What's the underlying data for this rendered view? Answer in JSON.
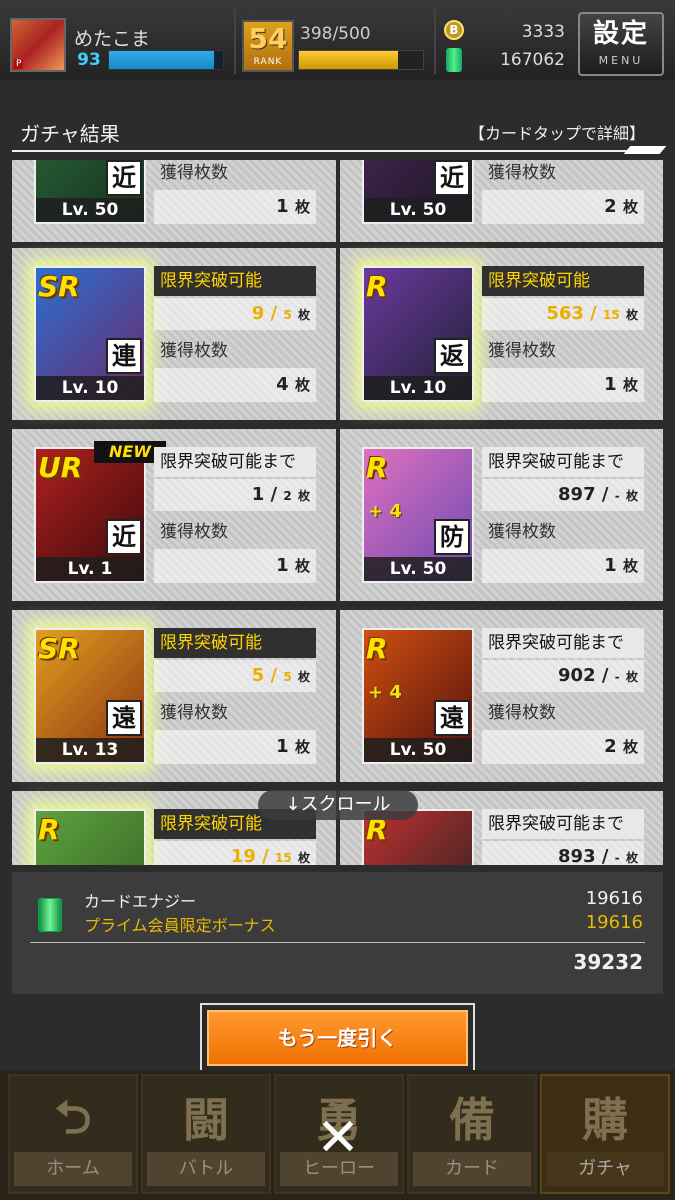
{
  "header": {
    "username": "めたこま",
    "level": "93",
    "xp_fraction": 0.92,
    "rank_label": "RANK",
    "rank_value": "54",
    "stamina": "398/500",
    "stamina_fraction": 0.8,
    "coin_symbol": "B",
    "coins": "3333",
    "energy": "167062",
    "settings_label": "設定",
    "settings_sub": "MENU"
  },
  "panel": {
    "title": "ガチャ結果",
    "hint": "【カードタップで詳細】"
  },
  "cards_top": [
    {
      "type": "近",
      "level": "Lv. 50",
      "count_label": "獲得枚数",
      "count": "1",
      "unit": "枚"
    },
    {
      "type": "近",
      "level": "Lv. 50",
      "count_label": "獲得枚数",
      "count": "2",
      "unit": "枚"
    }
  ],
  "cards": [
    {
      "rarity": "SR",
      "plus": "",
      "type": "連",
      "level": "Lv. 10",
      "status": "限界突破可能",
      "current": "9",
      "max": "5",
      "unit": "枚",
      "count_label": "獲得枚数",
      "count": "4",
      "isNew": ""
    },
    {
      "rarity": "R",
      "plus": "",
      "type": "返",
      "level": "Lv. 10",
      "status": "限界突破可能",
      "current": "563",
      "max": "15",
      "unit": "枚",
      "count_label": "獲得枚数",
      "count": "1",
      "isNew": ""
    },
    {
      "rarity": "UR",
      "plus": "",
      "type": "近",
      "level": "Lv. 1",
      "status": "限界突破可能まで",
      "current": "1",
      "max": "2",
      "unit": "枚",
      "count_label": "獲得枚数",
      "count": "1",
      "isNew": "NEW"
    },
    {
      "rarity": "R",
      "plus": "+ 4",
      "type": "防",
      "level": "Lv. 50",
      "status": "限界突破可能まで",
      "current": "897",
      "max": "-",
      "unit": "枚",
      "count_label": "獲得枚数",
      "count": "1",
      "isNew": ""
    },
    {
      "rarity": "SR",
      "plus": "",
      "type": "遠",
      "level": "Lv. 13",
      "status": "限界突破可能",
      "current": "5",
      "max": "5",
      "unit": "枚",
      "count_label": "獲得枚数",
      "count": "1",
      "isNew": ""
    },
    {
      "rarity": "R",
      "plus": "+ 4",
      "type": "遠",
      "level": "Lv. 50",
      "status": "限界突破可能まで",
      "current": "902",
      "max": "-",
      "unit": "枚",
      "count_label": "獲得枚数",
      "count": "2",
      "isNew": ""
    },
    {
      "rarity": "R",
      "plus": "",
      "type": "",
      "level": "",
      "status": "限界突破可能",
      "current": "19",
      "max": "15",
      "unit": "枚",
      "count_label": "",
      "count": "",
      "isNew": ""
    },
    {
      "rarity": "R",
      "plus": "",
      "type": "",
      "level": "",
      "status": "限界突破可能まで",
      "current": "893",
      "max": "-",
      "unit": "枚",
      "count_label": "",
      "count": "",
      "isNew": ""
    }
  ],
  "scroll_hint": "↓スクロール",
  "summary": {
    "energy_label": "カードエナジー",
    "energy_value": "19616",
    "bonus_label": "プライム会員限定ボーナス",
    "bonus_value": "19616",
    "total": "39232"
  },
  "redraw_label": "もう一度引く",
  "nav": [
    {
      "label": "ホーム",
      "icon": "home-icon",
      "glyph": "⮌"
    },
    {
      "label": "バトル",
      "icon": "battle-icon",
      "glyph": "闘"
    },
    {
      "label": "ヒーロー",
      "icon": "hero-icon",
      "glyph": "勇"
    },
    {
      "label": "カード",
      "icon": "card-icon",
      "glyph": "備"
    },
    {
      "label": "ガチャ",
      "icon": "gacha-icon",
      "glyph": "購"
    }
  ],
  "close_glyph": "✕",
  "colors": {
    "accent": "#f07000",
    "gold": "#e9b000",
    "glow": "#f0ff8c"
  }
}
